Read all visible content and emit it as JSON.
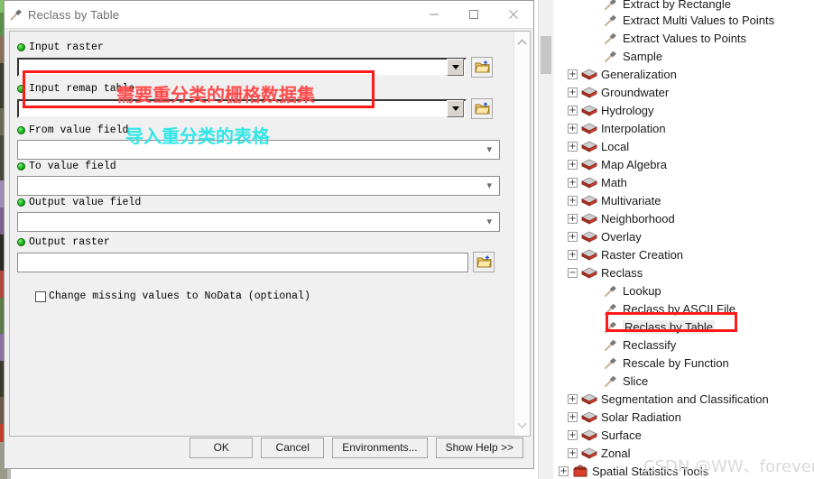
{
  "dialog": {
    "title": "Reclass by Table",
    "title_icon": "hammer-tool-icon",
    "window_controls": {
      "minimize": "—",
      "maximize": "□",
      "close": "✕"
    },
    "fields": [
      {
        "label": "Input raster",
        "value": "",
        "control": "combo"
      },
      {
        "label": "Input remap table",
        "value": "",
        "control": "combo"
      },
      {
        "label": "From value field",
        "value": "",
        "control": "select"
      },
      {
        "label": "To value field",
        "value": "",
        "control": "select"
      },
      {
        "label": "Output value field",
        "value": "",
        "control": "select"
      },
      {
        "label": "Output raster",
        "value": "",
        "control": "text"
      }
    ],
    "checkbox": {
      "label": "Change missing values to NoData (optional)",
      "checked": false
    },
    "buttons": [
      {
        "label": "OK"
      },
      {
        "label": "Cancel"
      },
      {
        "label": "Environments..."
      },
      {
        "label": "Show Help >>"
      }
    ]
  },
  "annotations": {
    "red_text": "需要重分类的栅格数据集",
    "cyan_text": "导入重分类的表格",
    "red_color": "#ff4d4d",
    "cyan_color": "#33e6e6",
    "box_color": "#ff1a1a"
  },
  "tree": {
    "items": [
      {
        "label": "Extract by Rectangle",
        "indent": 2,
        "icon": "hammer-tool-icon",
        "expander": "none",
        "selected": false,
        "clipped": true
      },
      {
        "label": "Extract Multi Values to Points",
        "indent": 2,
        "icon": "hammer-tool-icon",
        "expander": "none",
        "selected": false
      },
      {
        "label": "Extract Values to Points",
        "indent": 2,
        "icon": "hammer-tool-icon",
        "expander": "none",
        "selected": false
      },
      {
        "label": "Sample",
        "indent": 2,
        "icon": "hammer-tool-icon",
        "expander": "none",
        "selected": false
      },
      {
        "label": "Generalization",
        "indent": 1,
        "icon": "toolset-icon",
        "expander": "plus",
        "selected": false
      },
      {
        "label": "Groundwater",
        "indent": 1,
        "icon": "toolset-icon",
        "expander": "plus",
        "selected": false
      },
      {
        "label": "Hydrology",
        "indent": 1,
        "icon": "toolset-icon",
        "expander": "plus",
        "selected": false
      },
      {
        "label": "Interpolation",
        "indent": 1,
        "icon": "toolset-icon",
        "expander": "plus",
        "selected": false
      },
      {
        "label": "Local",
        "indent": 1,
        "icon": "toolset-icon",
        "expander": "plus",
        "selected": false
      },
      {
        "label": "Map Algebra",
        "indent": 1,
        "icon": "toolset-icon",
        "expander": "plus",
        "selected": false
      },
      {
        "label": "Math",
        "indent": 1,
        "icon": "toolset-icon",
        "expander": "plus",
        "selected": false
      },
      {
        "label": "Multivariate",
        "indent": 1,
        "icon": "toolset-icon",
        "expander": "plus",
        "selected": false
      },
      {
        "label": "Neighborhood",
        "indent": 1,
        "icon": "toolset-icon",
        "expander": "plus",
        "selected": false
      },
      {
        "label": "Overlay",
        "indent": 1,
        "icon": "toolset-icon",
        "expander": "plus",
        "selected": false
      },
      {
        "label": "Raster Creation",
        "indent": 1,
        "icon": "toolset-icon",
        "expander": "plus",
        "selected": false
      },
      {
        "label": "Reclass",
        "indent": 1,
        "icon": "toolset-icon",
        "expander": "minus",
        "selected": false
      },
      {
        "label": "Lookup",
        "indent": 2,
        "icon": "hammer-tool-icon",
        "expander": "none",
        "selected": false
      },
      {
        "label": "Reclass by ASCII File",
        "indent": 2,
        "icon": "hammer-tool-icon",
        "expander": "none",
        "selected": false
      },
      {
        "label": "Reclass by Table",
        "indent": 2,
        "icon": "hammer-tool-icon",
        "expander": "none",
        "selected": true
      },
      {
        "label": "Reclassify",
        "indent": 2,
        "icon": "hammer-tool-icon",
        "expander": "none",
        "selected": false
      },
      {
        "label": "Rescale by Function",
        "indent": 2,
        "icon": "hammer-tool-icon",
        "expander": "none",
        "selected": false
      },
      {
        "label": "Slice",
        "indent": 2,
        "icon": "hammer-tool-icon",
        "expander": "none",
        "selected": false
      },
      {
        "label": "Segmentation and Classification",
        "indent": 1,
        "icon": "toolset-icon",
        "expander": "plus",
        "selected": false
      },
      {
        "label": "Solar Radiation",
        "indent": 1,
        "icon": "toolset-icon",
        "expander": "plus",
        "selected": false
      },
      {
        "label": "Surface",
        "indent": 1,
        "icon": "toolset-icon",
        "expander": "plus",
        "selected": false
      },
      {
        "label": "Zonal",
        "indent": 1,
        "icon": "toolset-icon",
        "expander": "plus",
        "selected": false
      },
      {
        "label": "Spatial Statistics Tools",
        "indent": 0,
        "icon": "toolbox-icon",
        "expander": "plus",
        "selected": false
      }
    ]
  },
  "watermark": {
    "text": "CSDN @WW、forever"
  }
}
